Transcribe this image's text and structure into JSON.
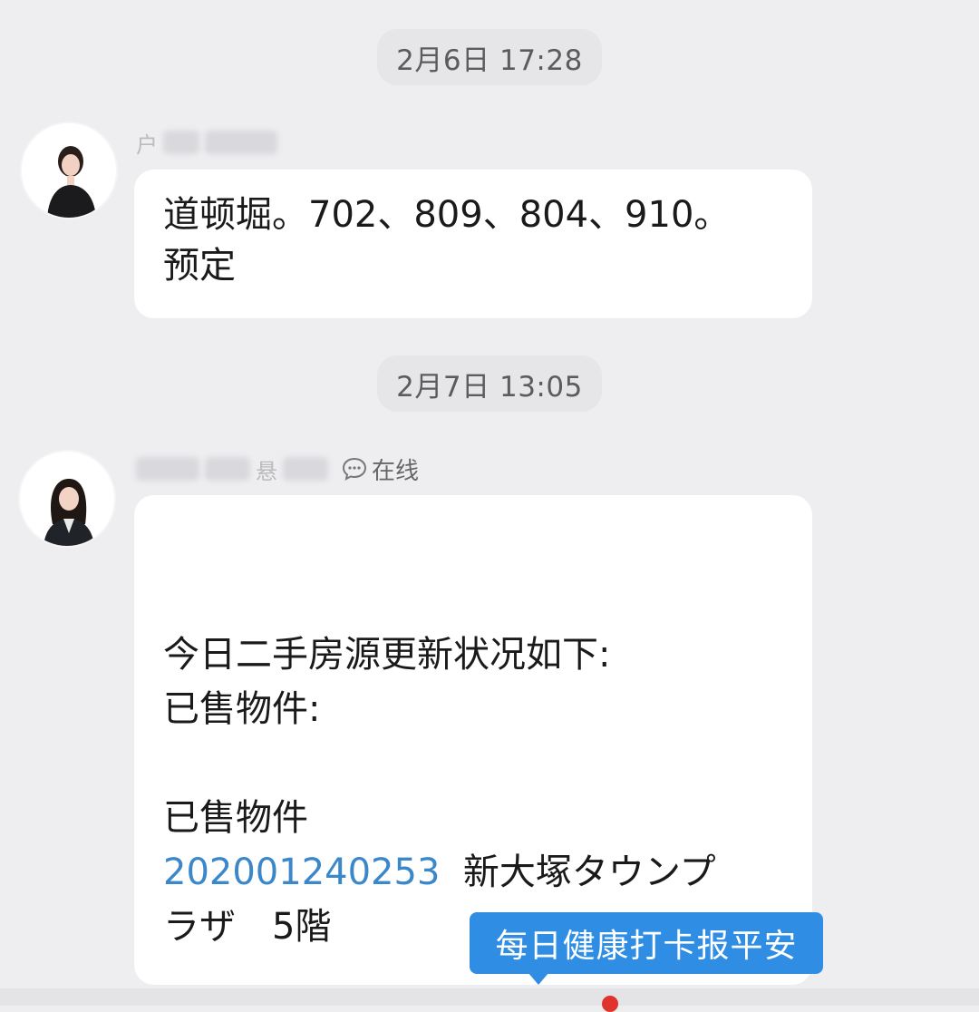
{
  "messages": [
    {
      "timestamp": "2月6日 17:28",
      "sender_visible_char": "户",
      "lines": [
        "道顿堀。702、809、804、910。",
        "预定"
      ]
    },
    {
      "timestamp": "2月7日 13:05",
      "sender_visible_char": "悬",
      "status": "在线",
      "lines": {
        "l1": "今日二手房源更新状况如下:",
        "l2": "已售物件:",
        "l3": "已售物件",
        "l4_link": "202001240253",
        "l4_text": "  新大塚タウンプ",
        "l5": "ラザ　5階"
      }
    }
  ],
  "tooltip": {
    "label": "每日健康打卡报平安"
  },
  "colors": {
    "accent": "#2f8ee3",
    "link": "#3a87c9",
    "badge": "#e0332d"
  }
}
